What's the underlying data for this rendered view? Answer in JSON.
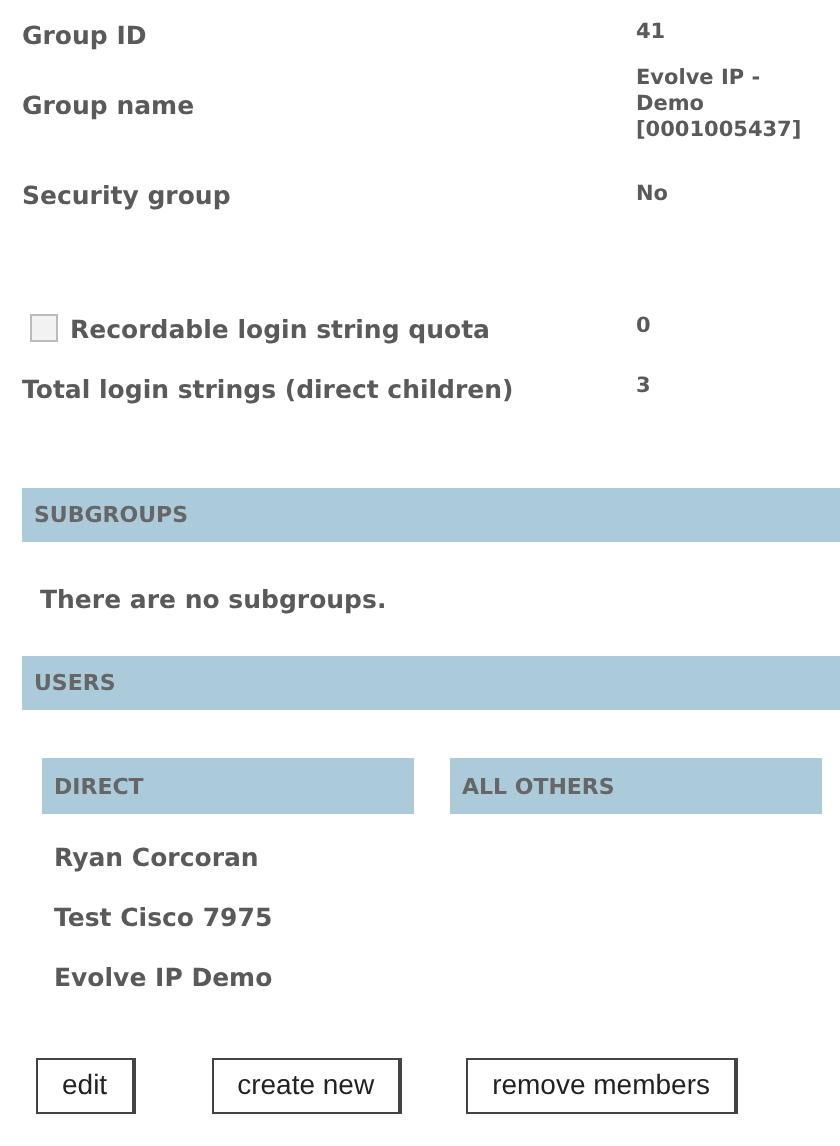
{
  "properties": [
    {
      "label": "Group ID",
      "value_lines": [
        "41"
      ]
    },
    {
      "label": "Group name",
      "value_lines": [
        "Evolve IP -",
        "Demo",
        "[0001005437]"
      ]
    },
    {
      "label": "Security group",
      "value_lines": [
        "No"
      ]
    }
  ],
  "quota": {
    "label": "Recordable login string quota",
    "checked": false,
    "value": "0"
  },
  "total": {
    "label": "Total login strings (direct children)",
    "value": "3"
  },
  "subgroups": {
    "title": "SUBGROUPS",
    "message": "There are no subgroups."
  },
  "users": {
    "title": "USERS",
    "columns": [
      "DIRECT",
      "ALL OTHERS"
    ],
    "direct": [
      "Ryan Corcoran",
      "Test Cisco 7975",
      "Evolve IP Demo"
    ]
  },
  "buttons": [
    "edit",
    "create new",
    "remove members"
  ]
}
